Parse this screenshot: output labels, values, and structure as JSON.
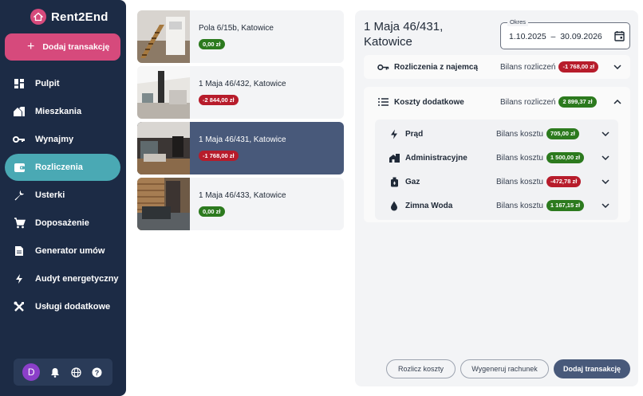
{
  "app": {
    "name": "Rent2End"
  },
  "sidebar": {
    "add_button": "Dodaj transakcję",
    "items": [
      {
        "label": "Pulpit",
        "icon": "dashboard-icon"
      },
      {
        "label": "Mieszkania",
        "icon": "home-icon"
      },
      {
        "label": "Wynajmy",
        "icon": "key-icon"
      },
      {
        "label": "Rozliczenia",
        "icon": "wallet-icon",
        "active": true
      },
      {
        "label": "Usterki",
        "icon": "wrench-icon"
      },
      {
        "label": "Doposażenie",
        "icon": "cart-icon"
      },
      {
        "label": "Generator umów",
        "icon": "document-icon"
      },
      {
        "label": "Audyt energetyczny",
        "icon": "bolt-icon"
      },
      {
        "label": "Usługi dodatkowe",
        "icon": "tools-icon"
      }
    ],
    "avatar_initial": "D"
  },
  "properties": [
    {
      "address": "Pola 6/15b, Katowice",
      "balance": "0,00 zł",
      "status": "green"
    },
    {
      "address": "1 Maja 46/432, Katowice",
      "balance": "-2 844,00 zł",
      "status": "red"
    },
    {
      "address": "1 Maja 46/431, Katowice",
      "balance": "-1 768,00 zł",
      "status": "red",
      "selected": true
    },
    {
      "address": "1 Maja 46/433, Katowice",
      "balance": "0,00 zł",
      "status": "green"
    }
  ],
  "detail": {
    "title": "1 Maja 46/431, Katowice",
    "period_label": "Okres",
    "period_value": "1.10.2025  –  30.09.2026",
    "tenant_section": {
      "title": "Rozliczenia z najemcą",
      "balance_label": "Bilans rozliczeń",
      "balance": "-1 768,00 zł"
    },
    "costs_section": {
      "title": "Koszty dodatkowe",
      "balance_label": "Bilans rozliczeń",
      "balance": "2 899,37 zł",
      "items": [
        {
          "title": "Prąd",
          "balance_label": "Bilans kosztu",
          "balance": "705,00 zł",
          "status": "green"
        },
        {
          "title": "Administracyjne",
          "balance_label": "Bilans kosztu",
          "balance": "1 500,00 zł",
          "status": "green"
        },
        {
          "title": "Gaz",
          "balance_label": "Bilans kosztu",
          "balance": "-472,78 zł",
          "status": "red"
        },
        {
          "title": "Zimna Woda",
          "balance_label": "Bilans kosztu",
          "balance": "1 167,15 zł",
          "status": "green"
        }
      ]
    },
    "actions": {
      "settle": "Rozlicz koszty",
      "invoice": "Wygeneruj rachunek",
      "add": "Dodaj transakcję"
    }
  },
  "colors": {
    "sidebar": "#1c2b45",
    "accent_pink": "#d64a7c",
    "active_teal": "#4aa9b4",
    "selected": "#48597a",
    "positive": "#2c7a1e",
    "negative": "#b71c2b"
  }
}
